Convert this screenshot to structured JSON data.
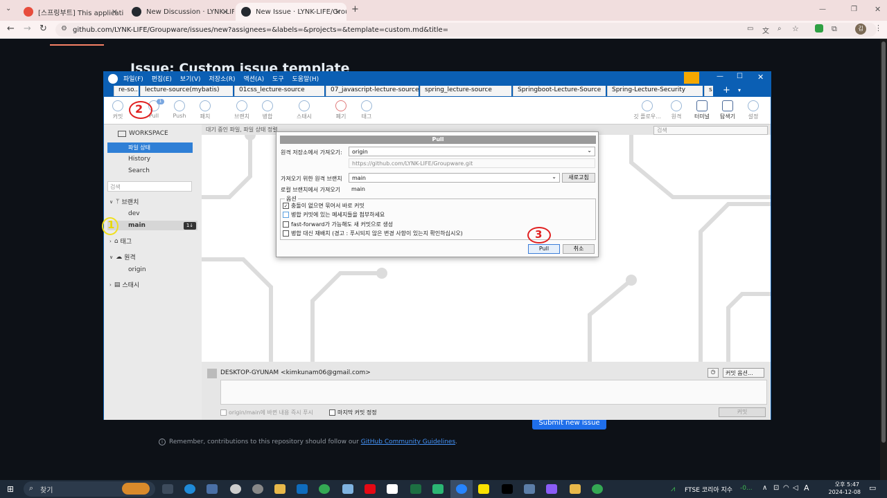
{
  "browser": {
    "tabs": [
      {
        "label": "[스프링부트] This application h",
        "color": "#e74c3c"
      },
      {
        "label": "New Discussion · LYNK-LIFE",
        "color": "#24292f"
      },
      {
        "label": "New Issue · LYNK-LIFE/Groupw",
        "color": "#24292f"
      }
    ],
    "new_tab": "+",
    "url": "github.com/LYNK-LIFE/Groupware/issues/new?assignees=&labels=&projects=&template=custom.md&title=",
    "profile": "김"
  },
  "github": {
    "title": "Issue: Custom issue template",
    "submit": "Submit new issue",
    "remember": "Remember, contributions to this repository should follow our",
    "guidelines": "GitHub Community Guidelines",
    "period": "."
  },
  "sourcetree": {
    "menu": [
      "파일(F)",
      "편집(E)",
      "보기(V)",
      "저장소(R)",
      "액션(A)",
      "도구",
      "도움말(H)"
    ],
    "tabs": [
      "re-so...",
      "lecture-source(mybatis)",
      "01css_lecture-source",
      "07_javascript-lecture-source",
      "spring_lecture-source",
      "Springboot-Lecture-Source",
      "Spring-Lecture-Security",
      "s"
    ],
    "toolbar_left": [
      "커밋",
      "Pull",
      "Push",
      "패치",
      "브랜치",
      "병합",
      "스태시",
      "폐기",
      "태그"
    ],
    "toolbar_right": [
      "깃 플로우...",
      "원격",
      "터미널",
      "탐색기",
      "설정"
    ],
    "pull_badge": "1",
    "sidebar": {
      "workspace": "WORKSPACE",
      "file_status": "파일 상태",
      "history": "History",
      "search": "Search",
      "search_placeholder": "검색",
      "branches": "브랜치",
      "dev": "dev",
      "main": "main",
      "main_badge": "1↓",
      "tags": "태그",
      "remotes": "원격",
      "origin": "origin",
      "stash": "스태시"
    },
    "filter": "대기 중인 파일, 파일 상태 정렬",
    "main_search": "검색",
    "author": "DESKTOP-GYUNAM <kimkunam06@gmail.com>",
    "commit_options": "커밋 옵션...",
    "push_immediately": "origin/main에 바뀐 내용 즉시 푸시",
    "amend": "마지막 커밋 정정",
    "commit_btn": "커밋"
  },
  "pull_dialog": {
    "title": "Pull",
    "remote_label": "원격 저장소에서 가져오기:",
    "remote_value": "origin",
    "remote_url": "https://github.com/LYNK-LIFE/Groupware.git",
    "branch_label": "가져오기 위한 원격 브랜치",
    "branch_value": "main",
    "refresh": "새로고침",
    "local_label": "로컬 브랜치에서 가져오기",
    "local_value": "main",
    "options_legend": "옵션",
    "opt1": "충돌이 없으면 묶어서 바로 커밋",
    "opt2": "병합 커밋에 있는 메세지들을 첨부하세요",
    "opt3": "fast-forward가 가능해도 새 커밋으로 생성",
    "opt4": "병합 대신 재배치 (경고 : 푸시되지 않은 변경 사항이 있는지 확인하십시오)",
    "pull_btn": "Pull",
    "cancel_btn": "취소"
  },
  "annotations": {
    "a1": "1",
    "a2": "2",
    "a3": "3"
  },
  "taskbar": {
    "search": "찾기",
    "ticker": "FTSE 코리아 지수",
    "ticker_val": "-0...",
    "ime": "A",
    "time": "오후 5:47",
    "date": "2024-12-08"
  }
}
